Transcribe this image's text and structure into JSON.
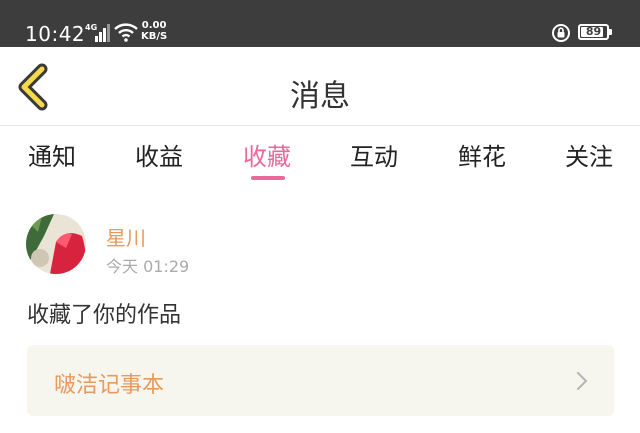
{
  "status_bar": {
    "time": "10:42",
    "network": "4G",
    "speed_value": "0.00",
    "speed_unit": "KB/S",
    "battery": "89",
    "battery_level": 0.89,
    "icons": [
      "signal-icon",
      "wifi-icon",
      "rotation-lock-icon",
      "battery-icon"
    ]
  },
  "header": {
    "title": "消息",
    "back_icon": "chevron-left-icon",
    "back_color": "#f5d94a"
  },
  "tabs": [
    {
      "label": "通知",
      "active": false
    },
    {
      "label": "收益",
      "active": false
    },
    {
      "label": "收藏",
      "active": true
    },
    {
      "label": "互动",
      "active": false
    },
    {
      "label": "鲜花",
      "active": false
    },
    {
      "label": "关注",
      "active": false
    }
  ],
  "message": {
    "username": "星川",
    "time": "今天 01:29",
    "text": "收藏了你的作品",
    "work_title": "啵洁记事本",
    "work_chevron": "chevron-right-icon"
  },
  "colors": {
    "accent": "#e8699c",
    "name": "#e89a5c",
    "status_bar": "#3d3d3d",
    "card_bg": "#f6f5ee"
  }
}
